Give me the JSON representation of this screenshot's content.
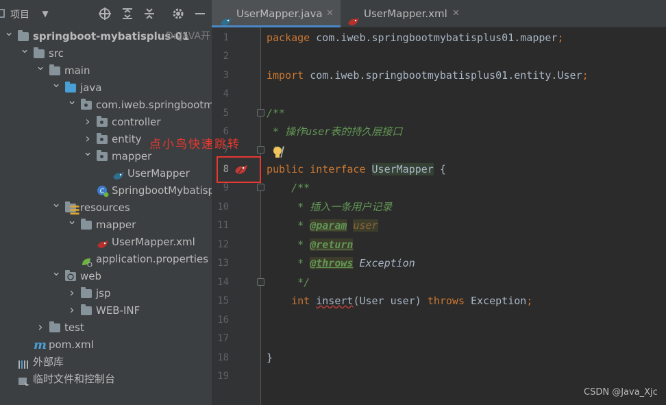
{
  "project_panel": {
    "title": "项目",
    "tree": [
      {
        "label": "springboot-mybatisplus-01",
        "hint": "D:\\JAVA开",
        "level": 0,
        "arrow": "down",
        "icon": "module-folder"
      },
      {
        "label": "src",
        "level": 1,
        "arrow": "down",
        "icon": "folder"
      },
      {
        "label": "main",
        "level": 2,
        "arrow": "down",
        "icon": "folder"
      },
      {
        "label": "java",
        "level": 3,
        "arrow": "down",
        "icon": "source-folder"
      },
      {
        "label": "com.iweb.springbootmyb",
        "level": 4,
        "arrow": "down",
        "icon": "package"
      },
      {
        "label": "controller",
        "level": 5,
        "arrow": "right",
        "icon": "package"
      },
      {
        "label": "entity",
        "level": 5,
        "arrow": "right",
        "icon": "package"
      },
      {
        "label": "mapper",
        "level": 5,
        "arrow": "down",
        "icon": "package"
      },
      {
        "label": "UserMapper",
        "level": 6,
        "arrow": "",
        "icon": "mapper-interface"
      },
      {
        "label": "SpringbootMybatisplus",
        "level": 5,
        "arrow": "",
        "icon": "spring-class"
      },
      {
        "label": "resources",
        "level": 3,
        "arrow": "down",
        "icon": "resources-folder"
      },
      {
        "label": "mapper",
        "level": 4,
        "arrow": "down",
        "icon": "folder"
      },
      {
        "label": "UserMapper.xml",
        "level": 5,
        "arrow": "",
        "icon": "mybatis-xml"
      },
      {
        "label": "application.properties",
        "level": 4,
        "arrow": "",
        "icon": "spring-properties"
      },
      {
        "label": "web",
        "level": 3,
        "arrow": "down",
        "icon": "web-folder"
      },
      {
        "label": "jsp",
        "level": 4,
        "arrow": "right",
        "icon": "folder"
      },
      {
        "label": "WEB-INF",
        "level": 4,
        "arrow": "right",
        "icon": "folder"
      },
      {
        "label": "test",
        "level": 2,
        "arrow": "right",
        "icon": "folder"
      },
      {
        "label": "pom.xml",
        "level": 1,
        "arrow": "",
        "icon": "maven"
      },
      {
        "label": "外部库",
        "level": 0,
        "arrow": "",
        "icon": "library"
      },
      {
        "label": "临时文件和控制台",
        "level": 0,
        "arrow": "",
        "icon": "scratches"
      }
    ]
  },
  "tabs": [
    {
      "label": "UserMapper.java",
      "active": true
    },
    {
      "label": "UserMapper.xml",
      "active": false
    }
  ],
  "editor": {
    "line_numbers": [
      "1",
      "2",
      "3",
      "4",
      "5",
      "6",
      "7",
      "8",
      "9",
      "10",
      "11",
      "12",
      "13",
      "14",
      "15",
      "16",
      "17",
      "18",
      "19"
    ],
    "code": {
      "l1_kw": "package",
      "l1_rest": " com.iweb.springbootmybatisplus01.mapper",
      "l1_semi": ";",
      "l3_kw": "import",
      "l3_rest": " com.iweb.springbootmybatisplus01.entity.User",
      "l3_semi": ";",
      "l5": "/**",
      "l6": " * 操作user表的持久层接口",
      "l7": " */",
      "l8_kw": "public interface",
      "l8_name": "UserMapper",
      "l8_rest": " {",
      "l9": "    /**",
      "l10": "     * 插入一条用户记录",
      "l11_star": "     * ",
      "l11_tag": "@param",
      "l11_param": "user",
      "l12_star": "     * ",
      "l12_tag": "@return",
      "l13_star": "     * ",
      "l13_tag": "@throws",
      "l13_text": " Exception",
      "l14": "     */",
      "l15_kw1": "    int",
      "l15_name": "insert",
      "l15_mid": "(User user) ",
      "l15_kw2": "throws",
      "l15_end": " Exception",
      "l15_semi": ";",
      "l18": "}"
    }
  },
  "annotation": {
    "text": "点小鸟快速跳转",
    "color": "#e8382f"
  },
  "watermark": "CSDN @Java_Xjc"
}
